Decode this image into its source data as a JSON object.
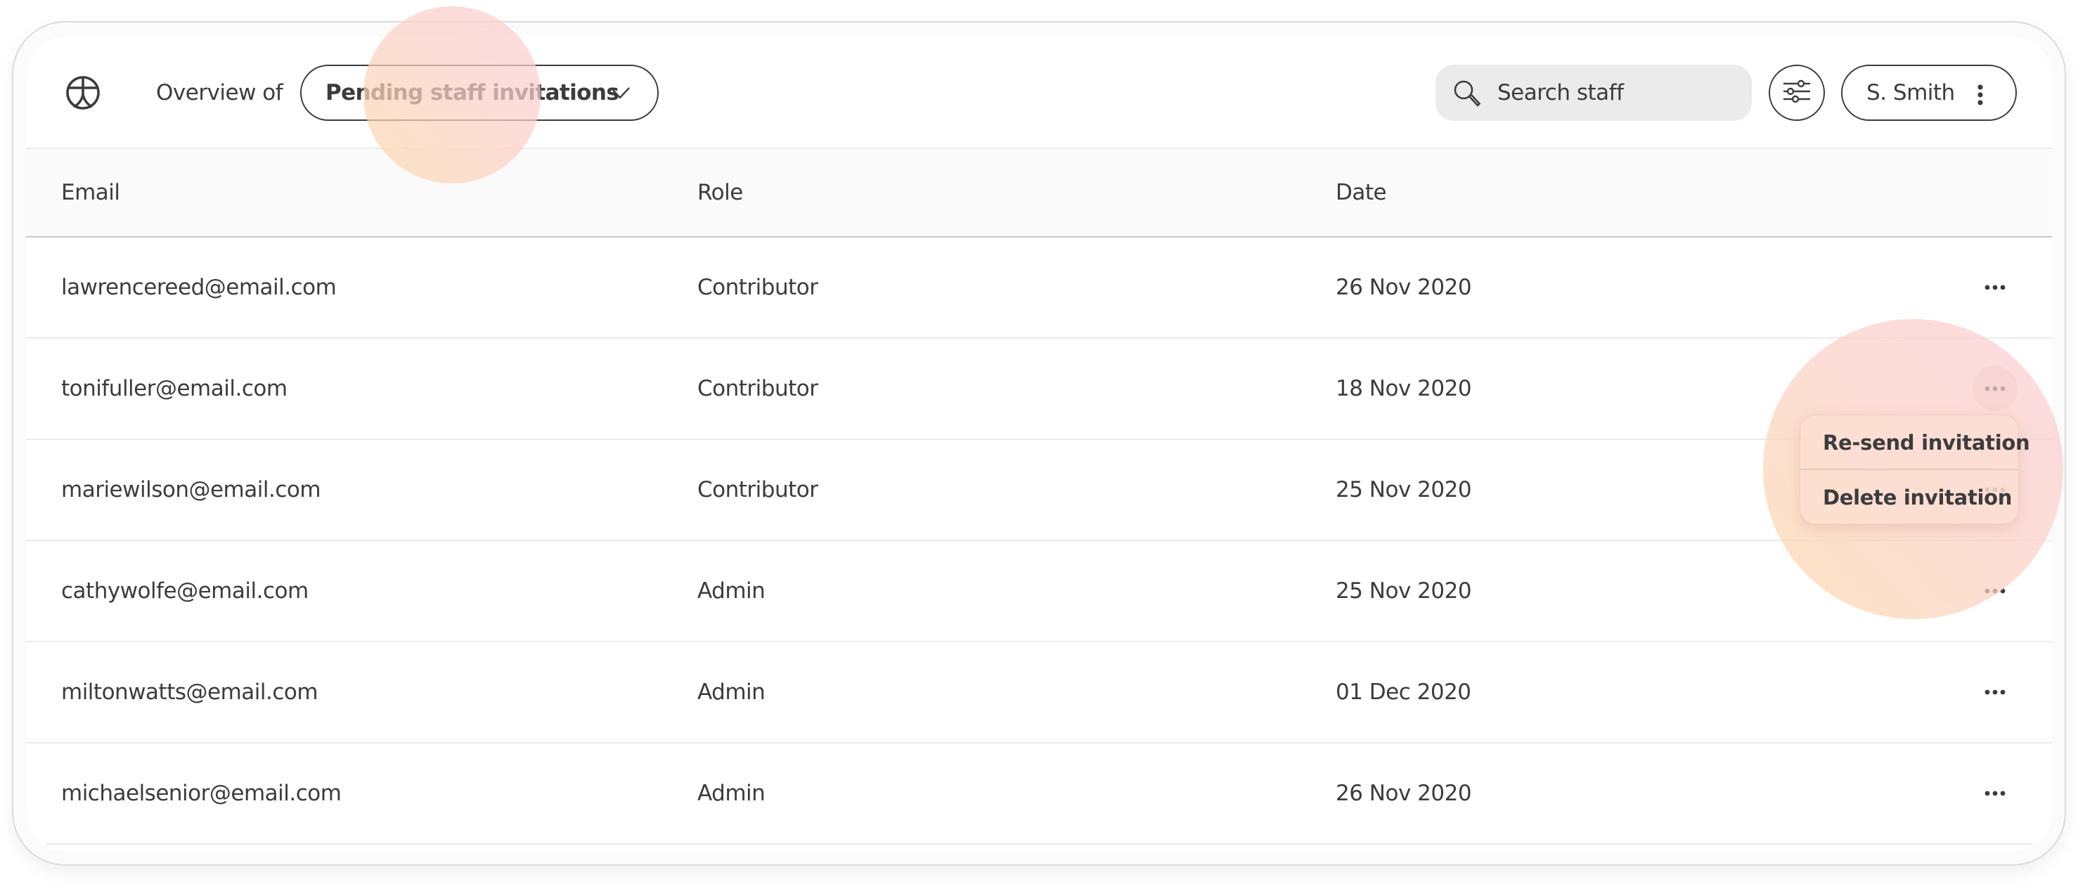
{
  "header": {
    "logo_icon": "accessibility-person-circle-icon",
    "overview_label": "Overview of",
    "view_select": {
      "selected": "Pending staff invitations",
      "icon": "chevron-down-icon"
    },
    "search": {
      "placeholder": "Search staff",
      "value": "",
      "icon": "search-icon"
    },
    "filter_button": {
      "icon": "sliders-icon"
    },
    "user_menu": {
      "name": "S. Smith",
      "icon": "kebab-vertical-icon"
    }
  },
  "table": {
    "columns": [
      "Email",
      "Role",
      "Date"
    ],
    "rows": [
      {
        "email": "lawrencereed@email.com",
        "role": "Contributor",
        "date": "26 Nov 2020"
      },
      {
        "email": "tonifuller@email.com",
        "role": "Contributor",
        "date": "18 Nov 2020"
      },
      {
        "email": "mariewilson@email.com",
        "role": "Contributor",
        "date": "25 Nov 2020"
      },
      {
        "email": "cathywolfe@email.com",
        "role": "Admin",
        "date": "25 Nov 2020"
      },
      {
        "email": "miltonwatts@email.com",
        "role": "Admin",
        "date": "01 Dec 2020"
      },
      {
        "email": "michaelsenior@email.com",
        "role": "Admin",
        "date": "26 Nov 2020"
      }
    ],
    "row_action_icon": "more-horizontal-icon",
    "active_row_index": 1
  },
  "context_menu": {
    "items": [
      "Re-send invitation",
      "Delete invitation"
    ]
  },
  "colors": {
    "text": "#3c3c3e",
    "header_bg": "#fafafa",
    "search_bg": "#ebebeb",
    "highlight_start": "#fdd8aa",
    "highlight_end": "#fbced2"
  }
}
